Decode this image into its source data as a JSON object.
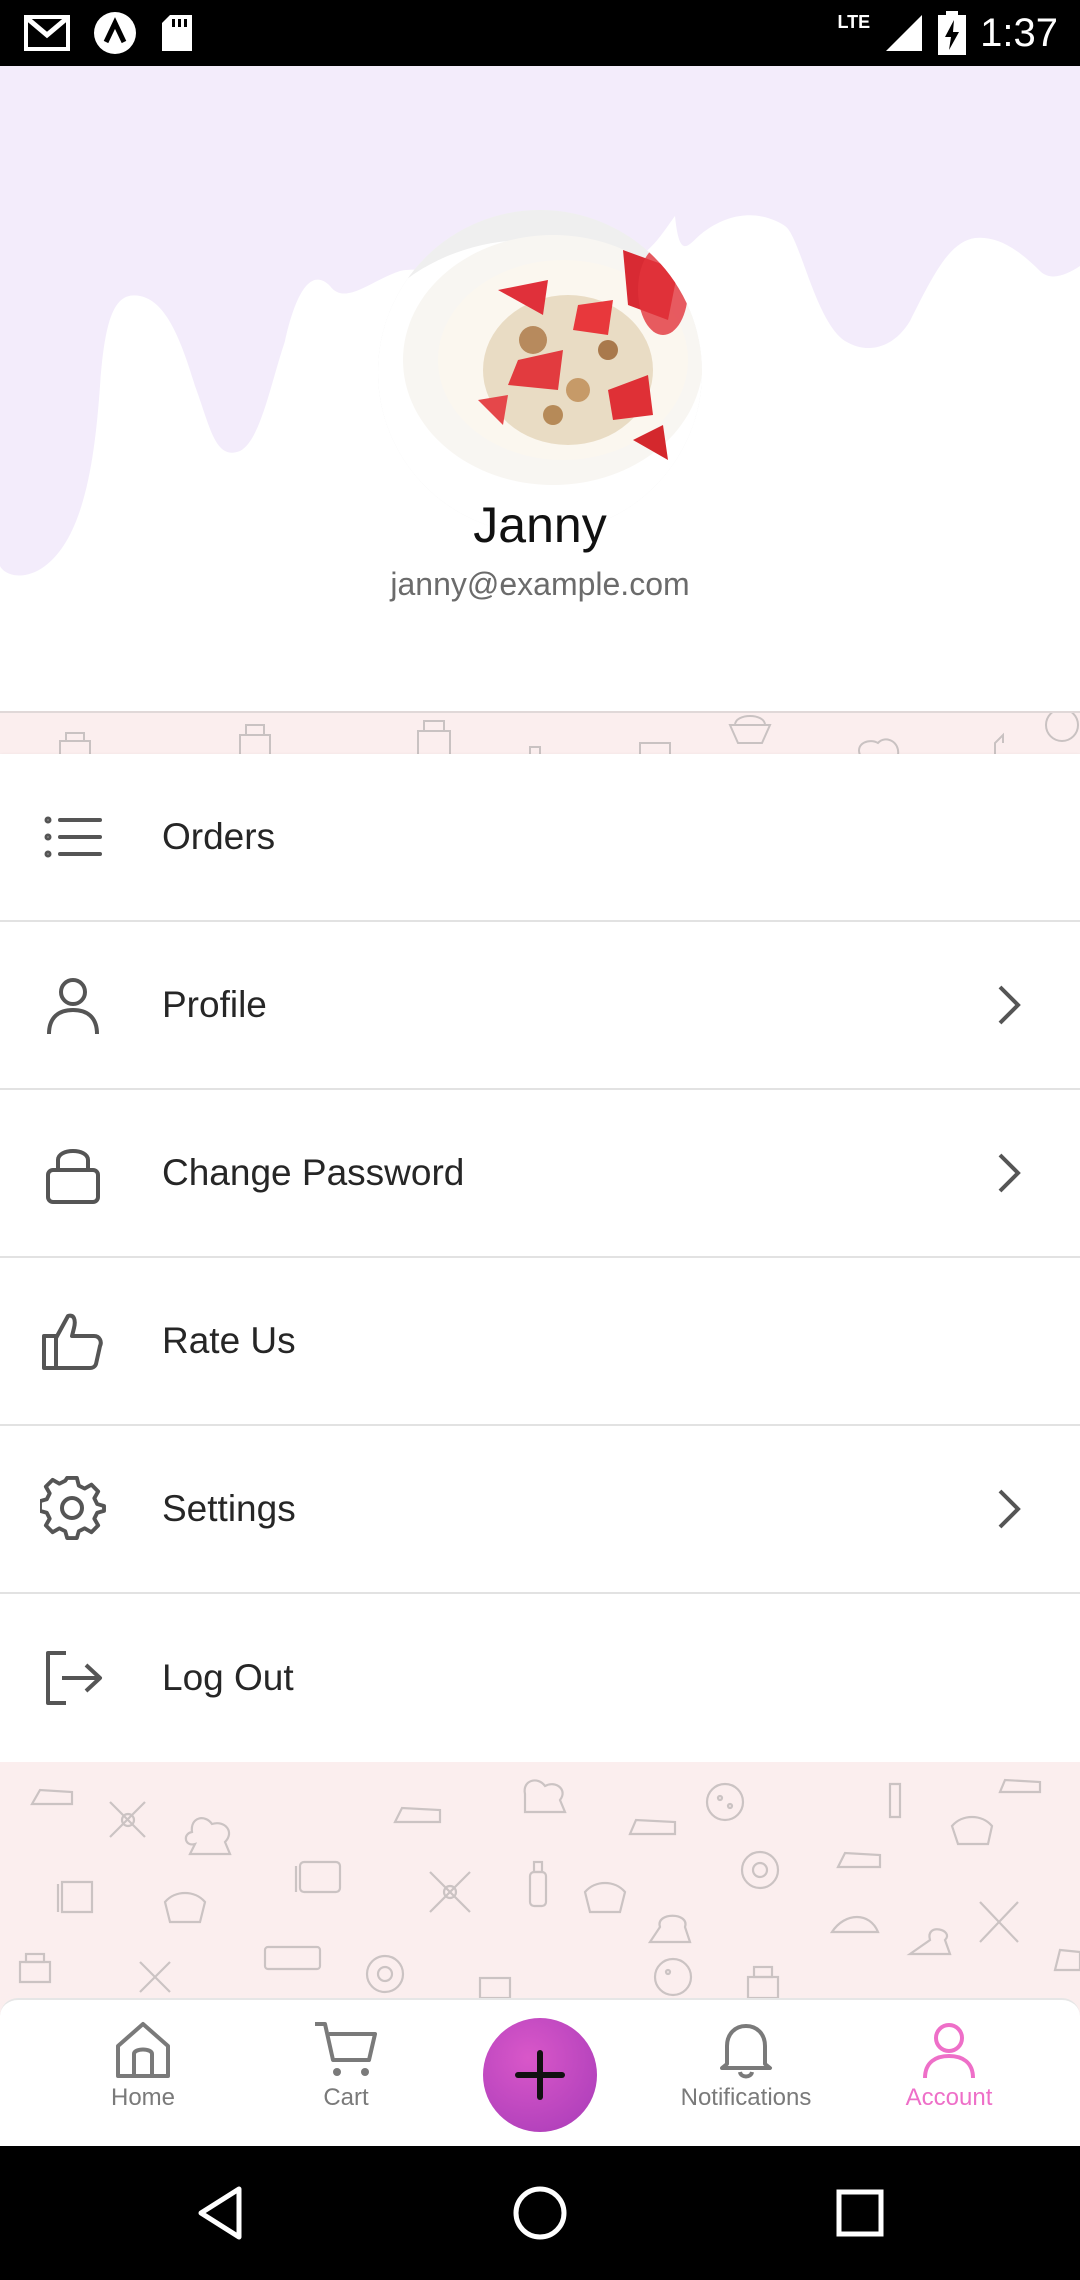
{
  "status_bar": {
    "time": "1:37",
    "network": "LTE",
    "left_icons": [
      "gmail-icon",
      "app-icon",
      "sd-card-icon"
    ],
    "right_icons": [
      "signal-icon",
      "battery-charging-icon"
    ]
  },
  "profile": {
    "name": "Janny",
    "email": "janny@example.com",
    "avatar": "food-avatar-image"
  },
  "menu": {
    "items": [
      {
        "label": "Orders",
        "icon": "list-icon",
        "chevron": false
      },
      {
        "label": "Profile",
        "icon": "person-icon",
        "chevron": true
      },
      {
        "label": "Change Password",
        "icon": "lock-icon",
        "chevron": true
      },
      {
        "label": "Rate Us",
        "icon": "thumbs-up-icon",
        "chevron": false
      },
      {
        "label": "Settings",
        "icon": "gear-icon",
        "chevron": true
      },
      {
        "label": "Log Out",
        "icon": "logout-icon",
        "chevron": false
      }
    ]
  },
  "bottom_nav": {
    "items": [
      {
        "label": "Home",
        "icon": "home-icon"
      },
      {
        "label": "Cart",
        "icon": "cart-icon"
      },
      {
        "label": "Notifications",
        "icon": "bell-icon"
      },
      {
        "label": "Account",
        "icon": "account-icon",
        "active": true
      }
    ],
    "fab_icon": "plus-icon"
  },
  "colors": {
    "accent": "#ee6fc8",
    "fab": "#b845bf",
    "header_drip": "#f3ecfb",
    "pattern_bg": "#fbeeee"
  }
}
